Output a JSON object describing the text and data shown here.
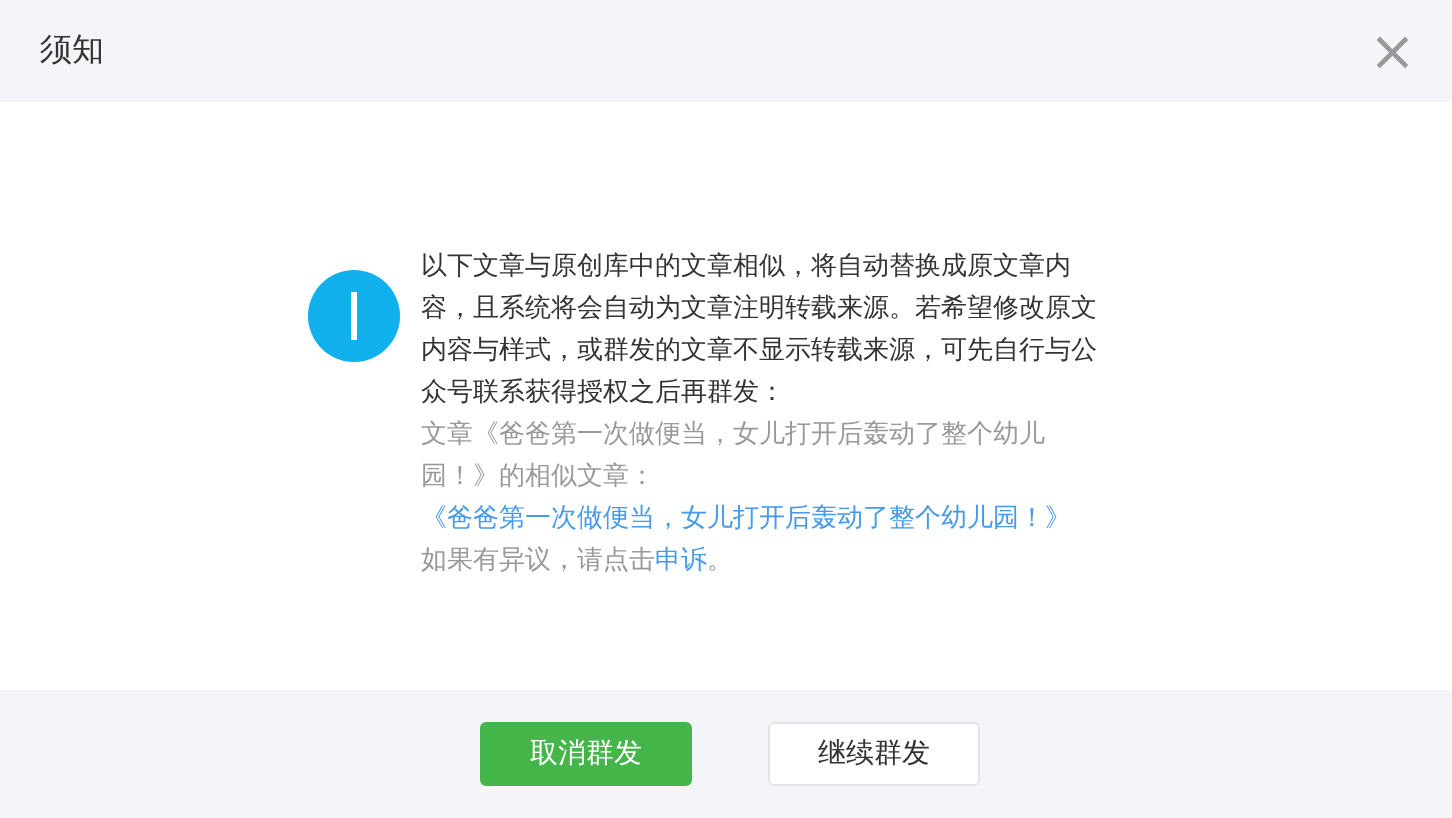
{
  "dialog": {
    "title": "须知",
    "close": "×"
  },
  "notice": "以下文章与原创库中的文章相似，将自动替换成原文章内容，且系统将会自动为文章注明转载来源。若希望修改原文内容与样式，或群发的文章不显示转载来源，可先自行与公众号联系获得授权之后再群发：",
  "similar": {
    "text": "文章《爸爸第一次做便当，女儿打开后轰动了整个幼儿园！》的相似文章：",
    "link": "《爸爸第一次做便当，女儿打开后轰动了整个幼儿园！》"
  },
  "appeal": {
    "text": "如果有异议，请点击",
    "link": "申诉",
    "text_after": "。"
  },
  "buttons": [
    {
      "label": "取消群发",
      "kind": "primary"
    },
    {
      "label": "继续群发",
      "kind": "secondary"
    }
  ]
}
